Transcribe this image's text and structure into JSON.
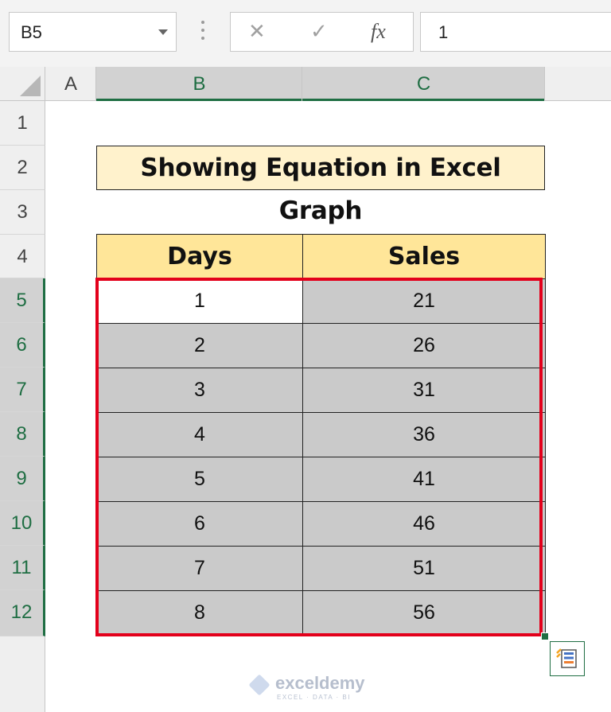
{
  "formula_bar": {
    "name_box": "B5",
    "formula_value": "1",
    "icons": [
      "cancel-icon",
      "enter-icon",
      "function-icon"
    ],
    "fx_label": "fx"
  },
  "columns": [
    {
      "label": "A",
      "selected": false
    },
    {
      "label": "B",
      "selected": true
    },
    {
      "label": "C",
      "selected": true
    }
  ],
  "rows": [
    {
      "label": "1",
      "selected": false
    },
    {
      "label": "2",
      "selected": false
    },
    {
      "label": "3",
      "selected": false
    },
    {
      "label": "4",
      "selected": false
    },
    {
      "label": "5",
      "selected": true
    },
    {
      "label": "6",
      "selected": true
    },
    {
      "label": "7",
      "selected": true
    },
    {
      "label": "8",
      "selected": true
    },
    {
      "label": "9",
      "selected": true
    },
    {
      "label": "10",
      "selected": true
    },
    {
      "label": "11",
      "selected": true
    },
    {
      "label": "12",
      "selected": true
    }
  ],
  "sheet": {
    "title": "Showing Equation in Excel Graph",
    "table": {
      "headers": [
        "Days",
        "Sales"
      ],
      "rows": [
        [
          "1",
          "21"
        ],
        [
          "2",
          "26"
        ],
        [
          "3",
          "31"
        ],
        [
          "4",
          "36"
        ],
        [
          "5",
          "41"
        ],
        [
          "6",
          "46"
        ],
        [
          "7",
          "51"
        ],
        [
          "8",
          "56"
        ]
      ]
    }
  },
  "colors": {
    "title_fill": "#fff2cc",
    "header_fill": "#ffe699",
    "selection_fill": "#cacaca",
    "selection_border": "#e3001b",
    "excel_green": "#1f6e43"
  },
  "watermark": {
    "name": "exceldemy",
    "tagline": "EXCEL · DATA · BI"
  }
}
